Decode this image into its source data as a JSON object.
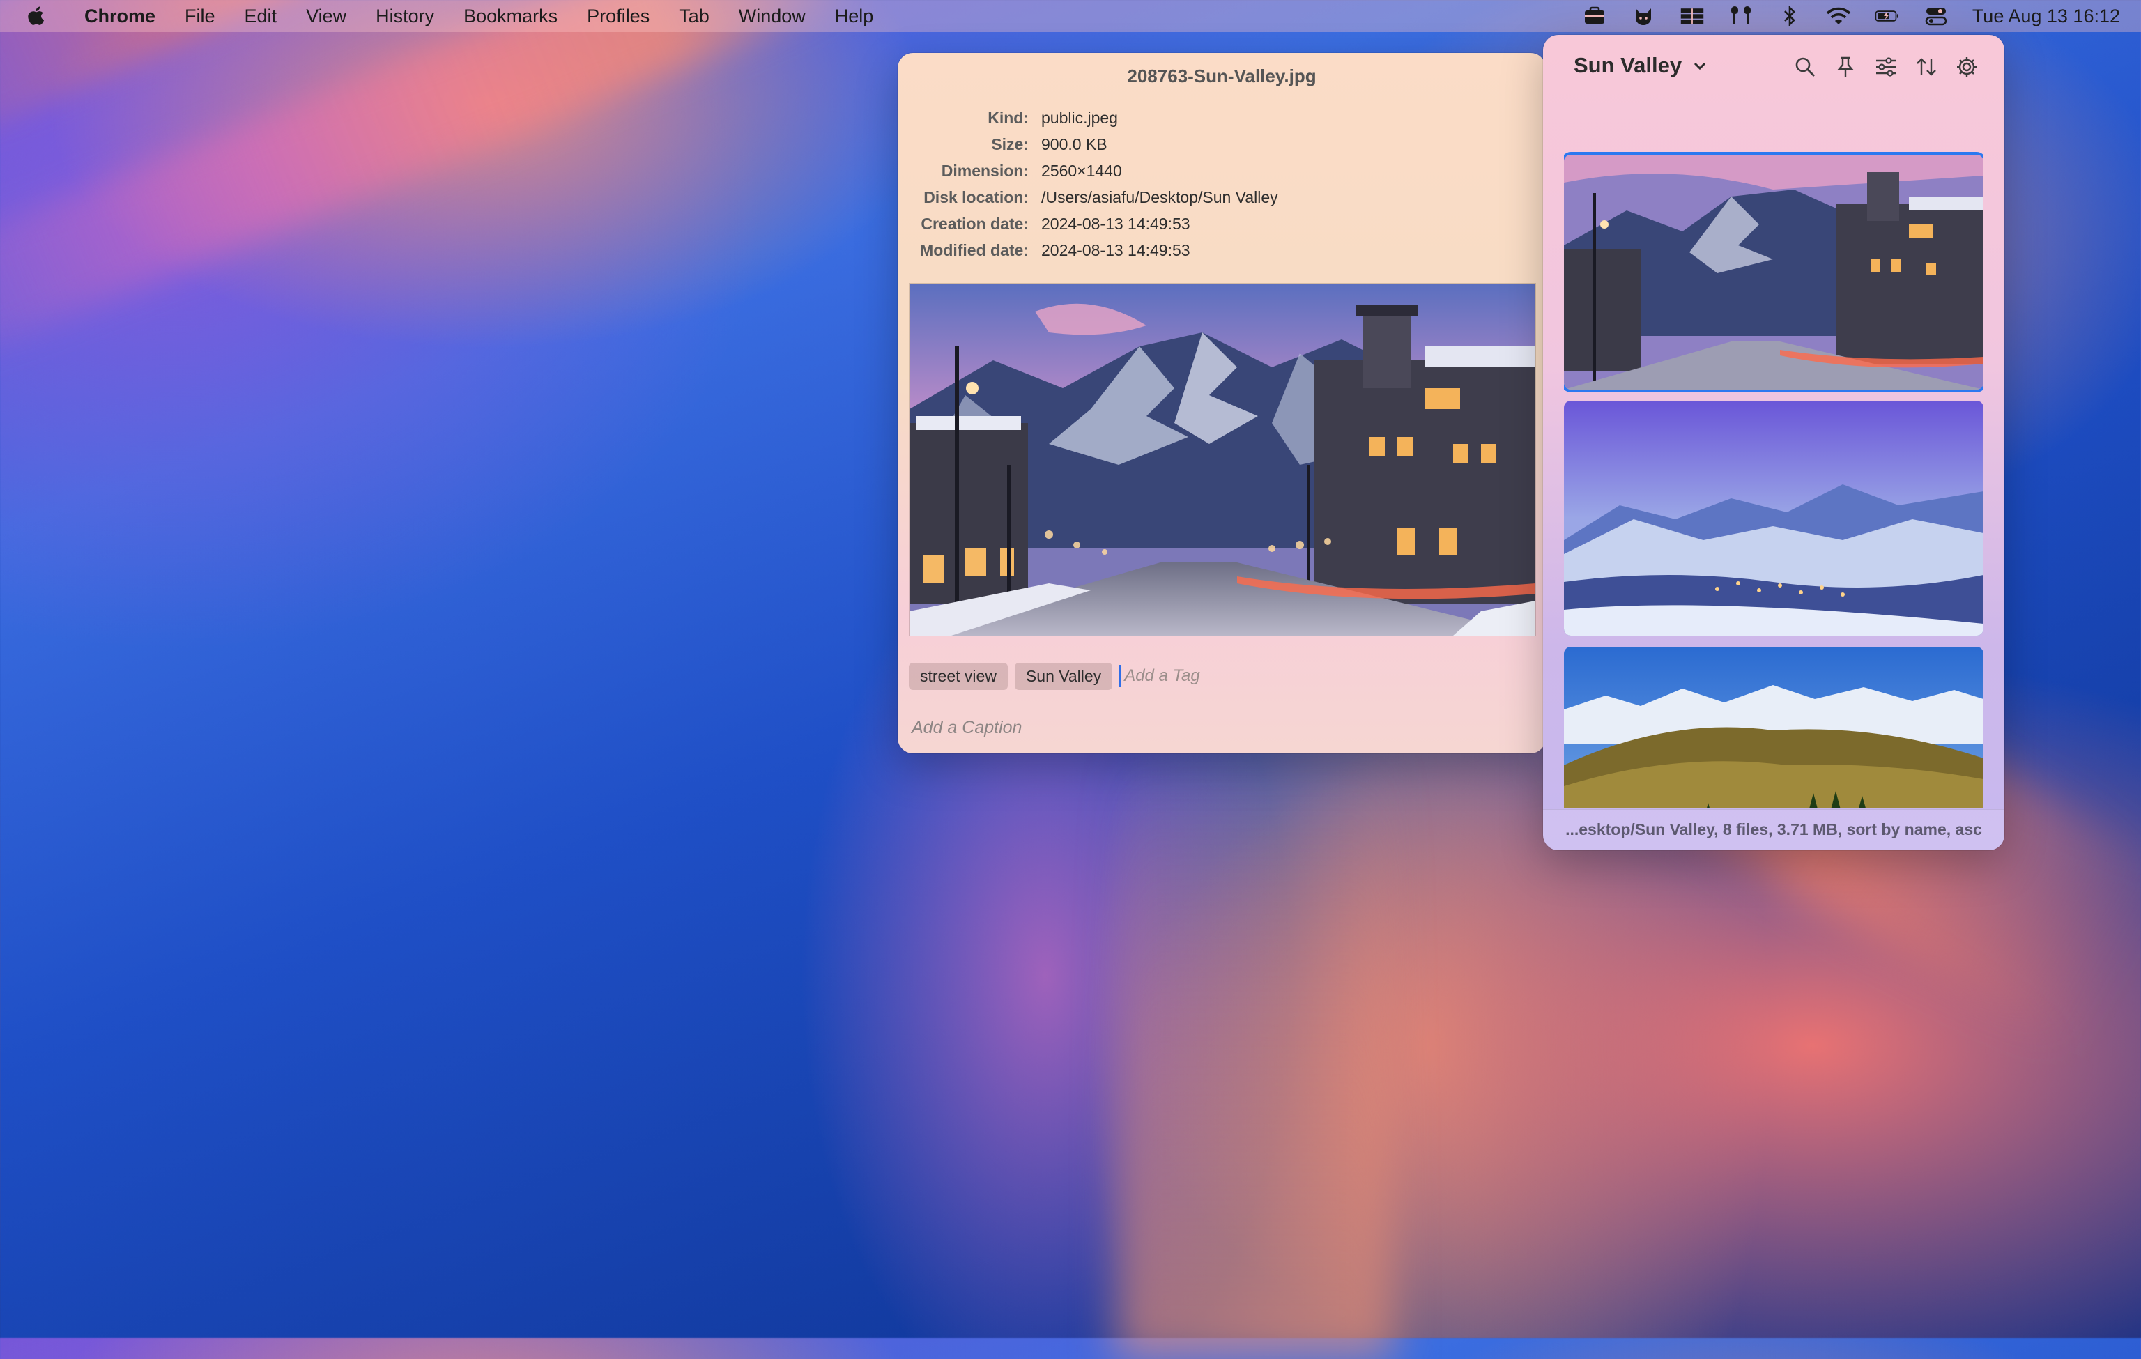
{
  "menubar": {
    "app_name": "Chrome",
    "menus": [
      "File",
      "Edit",
      "View",
      "History",
      "Bookmarks",
      "Profiles",
      "Tab",
      "Window",
      "Help"
    ],
    "status_icons": [
      "toolbox-icon",
      "cat-icon",
      "stack-icon",
      "airpods-icon",
      "bluetooth-icon",
      "wifi-icon",
      "battery-icon",
      "control-center-icon"
    ],
    "clock": "Tue Aug 13  16:12"
  },
  "info": {
    "filename": "208763-Sun-Valley.jpg",
    "properties": [
      {
        "key": "Kind:",
        "value": "public.jpeg"
      },
      {
        "key": "Size:",
        "value": "900.0 KB"
      },
      {
        "key": "Dimension:",
        "value": "2560×1440"
      },
      {
        "key": "Disk location:",
        "value": "/Users/asiafu/Desktop/Sun Valley"
      },
      {
        "key": "Creation date:",
        "value": "2024-08-13 14:49:53"
      },
      {
        "key": "Modified date:",
        "value": "2024-08-13 14:49:53"
      }
    ],
    "tags": [
      "street view",
      "Sun Valley"
    ],
    "tag_placeholder": "Add a Tag",
    "caption_placeholder": "Add a Caption"
  },
  "panel": {
    "folder": "Sun Valley",
    "tool_icons": [
      "search-icon",
      "pin-icon",
      "filter-icon",
      "sort-icon",
      "gear-icon"
    ],
    "status": "...esktop/Sun Valley, 8 files, 3.71 MB, sort by name, asc"
  }
}
